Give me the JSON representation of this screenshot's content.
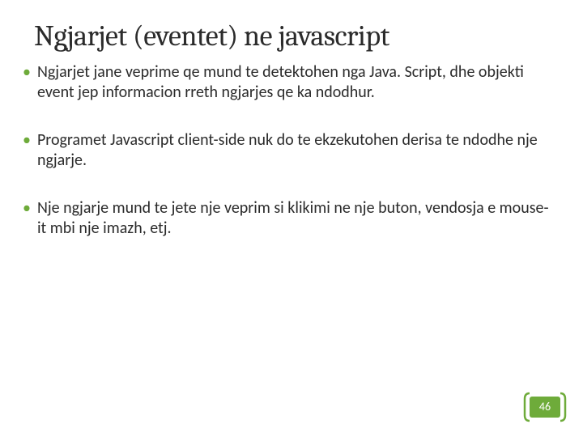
{
  "title": "Ngjarjet (eventet) ne javascript",
  "bullets": [
    "Ngjarjet jane veprime qe mund te detektohen nga Java. Script, dhe objekti event jep informacion rreth ngjarjes qe ka ndodhur.",
    "Programet Javascript client-side nuk do te ekzekutohen derisa te ndodhe nje ngjarje.",
    "Nje ngjarje mund te jete nje veprim si klikimi ne nje buton, vendosja e mouse-it mbi nje imazh, etj."
  ],
  "page_number": "46",
  "colors": {
    "accent": "#6eab3a"
  }
}
